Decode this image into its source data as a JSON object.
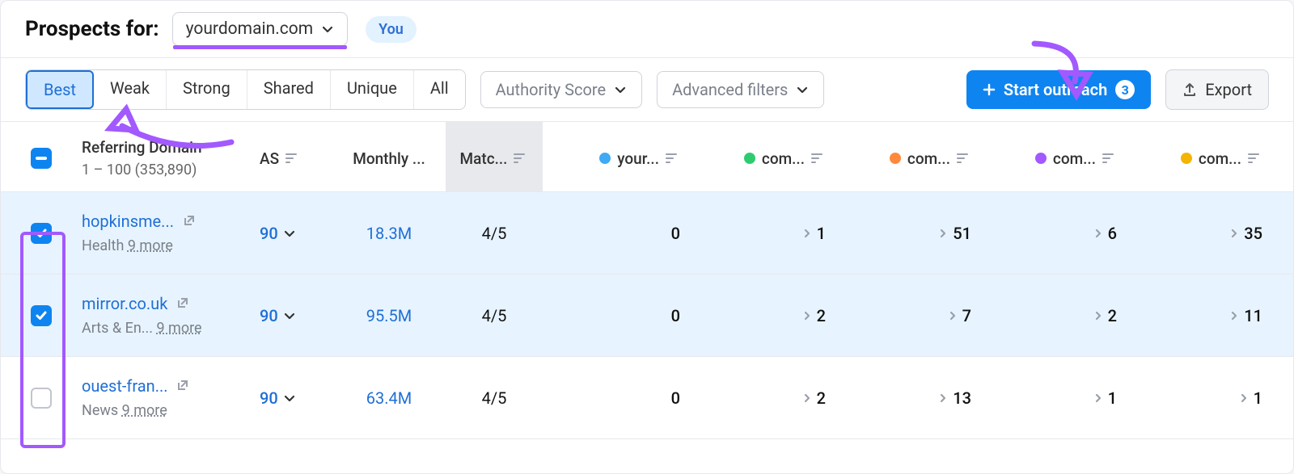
{
  "header": {
    "label": "Prospects for:",
    "domain": "yourdomain.com",
    "you_chip": "You"
  },
  "filters": {
    "tabs": [
      "Best",
      "Weak",
      "Strong",
      "Shared",
      "Unique",
      "All"
    ],
    "active_tab_index": 0,
    "authority_label": "Authority Score",
    "advanced_label": "Advanced filters"
  },
  "actions": {
    "outreach_label": "Start outreach",
    "outreach_count": "3",
    "export_label": "Export"
  },
  "columns": {
    "referring_title": "Referring Domain",
    "referring_sub": "1 – 100 (353,890)",
    "as": "AS",
    "monthly": "Monthly ...",
    "matches": "Matc...",
    "comp0": {
      "label": "your...",
      "color": "#3fa9f5"
    },
    "comp1": {
      "label": "com...",
      "color": "#2ecc71"
    },
    "comp2": {
      "label": "com...",
      "color": "#ff8a3d"
    },
    "comp3": {
      "label": "com...",
      "color": "#a259ff"
    },
    "comp4": {
      "label": "com...",
      "color": "#f5b400"
    }
  },
  "rows": [
    {
      "selected": true,
      "domain": "hopkinsme...",
      "category": "Health",
      "more": "9 more",
      "as": "90",
      "monthly": "18.3M",
      "matches": "4/5",
      "c0": "0",
      "c1": "1",
      "c2": "51",
      "c3": "6",
      "c4": "35"
    },
    {
      "selected": true,
      "domain": "mirror.co.uk",
      "category": "Arts & En...",
      "more": "9 more",
      "as": "90",
      "monthly": "95.5M",
      "matches": "4/5",
      "c0": "0",
      "c1": "2",
      "c2": "7",
      "c3": "2",
      "c4": "11"
    },
    {
      "selected": false,
      "domain": "ouest-fran...",
      "category": "News",
      "more": "9 more",
      "as": "90",
      "monthly": "63.4M",
      "matches": "4/5",
      "c0": "0",
      "c1": "2",
      "c2": "13",
      "c3": "1",
      "c4": "1"
    }
  ]
}
